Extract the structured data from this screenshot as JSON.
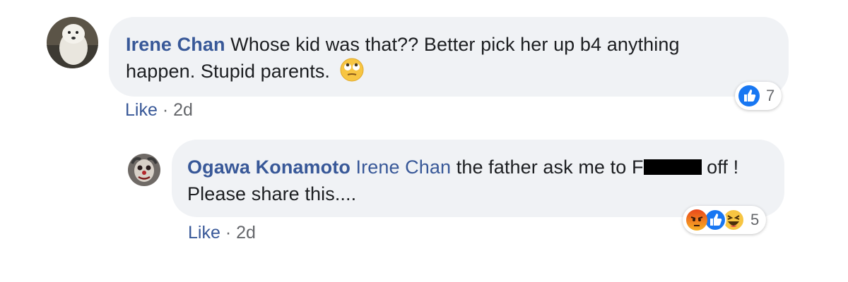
{
  "comments": [
    {
      "author": "Irene Chan",
      "text_line1": "Whose kid was that?? Better pick her up b4 anything",
      "text_line2": "happen. Stupid parents.",
      "emoji": "face-with-rolling-eyes-icon",
      "like_label": "Like",
      "separator": "·",
      "time": "2d",
      "reactions": [
        "like-reaction-icon"
      ],
      "reaction_count": "7"
    },
    {
      "author": "Ogawa Konamoto",
      "mention": "Irene Chan",
      "text_before_redaction": "the father ask me to F",
      "text_after_redaction": "off !",
      "text_line2": "Please share this....",
      "like_label": "Like",
      "separator": "·",
      "time": "2d",
      "reactions": [
        "angry-reaction-icon",
        "like-reaction-icon",
        "haha-reaction-icon"
      ],
      "reaction_count": "5"
    }
  ],
  "colors": {
    "name": "#385898",
    "bubble": "#f0f2f5",
    "meta": "#65676b",
    "like_blue": "#1877f2"
  }
}
